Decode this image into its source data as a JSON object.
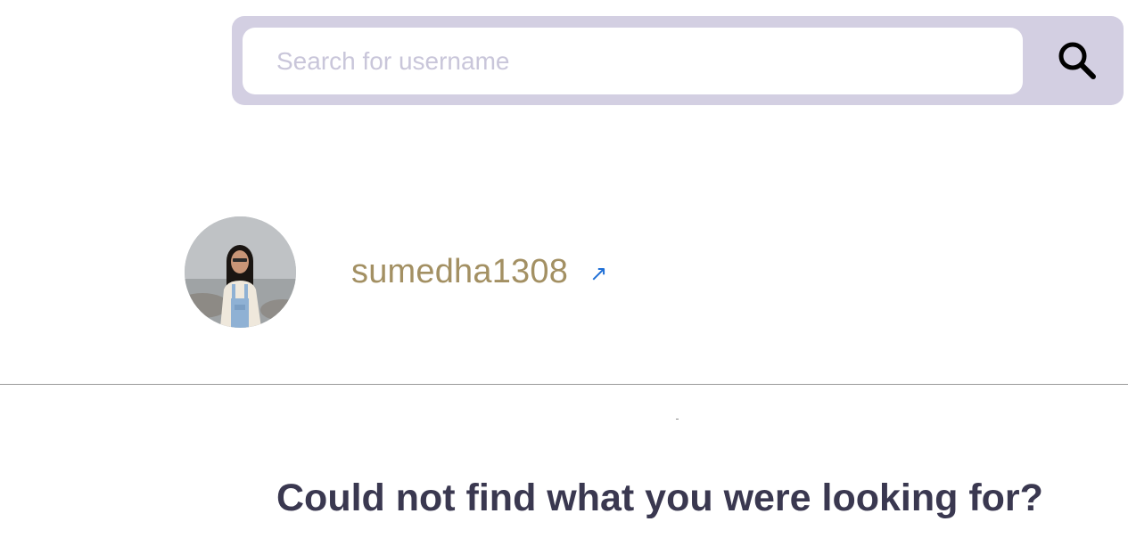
{
  "search": {
    "placeholder": "Search for username",
    "value": "",
    "icon": "search-icon",
    "bar_color": "#d3cfe2"
  },
  "results": [
    {
      "username": "sumedha1308",
      "link_icon": "↗",
      "username_color": "#a39063",
      "link_color": "#1f6fd6"
    }
  ],
  "footer": {
    "title": "Could not find what you were looking for?",
    "title_color": "#3a3850"
  }
}
